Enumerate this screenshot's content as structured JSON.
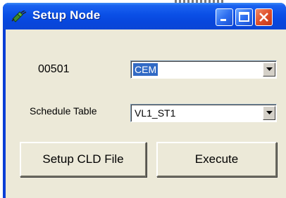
{
  "window": {
    "title": "Setup Node",
    "controls": {
      "minimize": "minimize-icon",
      "maximize": "maximize-icon",
      "close": "close-icon"
    },
    "icon": "plug-icon"
  },
  "node": {
    "id_label": "00501",
    "node_select": {
      "value": "CEM",
      "selected": true
    }
  },
  "schedule": {
    "label": "Schedule Table",
    "table_select": {
      "value": "VL1_ST1"
    }
  },
  "buttons": {
    "setup_cld": "Setup CLD File",
    "execute": "Execute"
  },
  "colors": {
    "titlebar": "#0a4fe6",
    "close_button": "#e0502a",
    "client_bg": "#ece9d8",
    "selection": "#316ac5"
  }
}
